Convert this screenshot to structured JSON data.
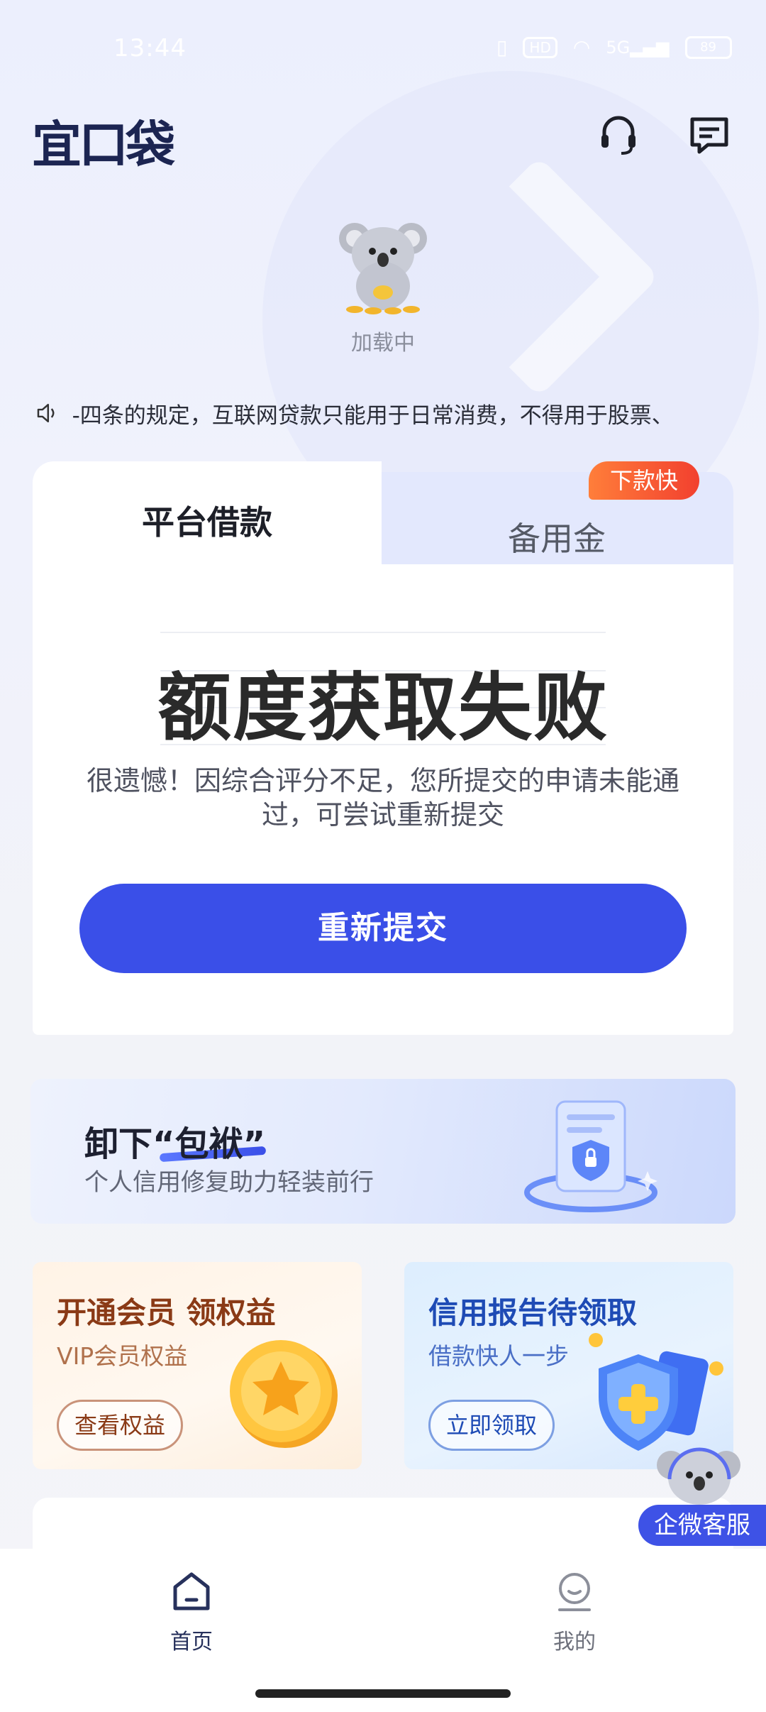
{
  "status_bar": {
    "time": "13:44",
    "hd": "HD",
    "network": "5G",
    "battery": "89"
  },
  "header": {
    "logo": "宜口袋",
    "service_icon": "headset-icon",
    "message_icon": "message-icon"
  },
  "loading": {
    "text": "加载中"
  },
  "notice": {
    "icon": "speaker-icon",
    "text": "-四条的规定，互联网贷款只能用于日常消费，不得用于股票、"
  },
  "loan_card": {
    "tabs": [
      {
        "label": "平台借款",
        "active": true
      },
      {
        "label": "备用金",
        "active": false,
        "badge": "下款快"
      }
    ],
    "status_title": "额度获取失败",
    "status_desc": "很遗憾！因综合评分不足，您所提交的申请未能通过，可尝试重新提交",
    "button_label": "重新提交"
  },
  "banner": {
    "title_prefix": "卸下",
    "title_highlight": "“包袱”",
    "subtitle": "个人信用修复助力轻装前行"
  },
  "promos": [
    {
      "title": "开通会员 领权益",
      "subtitle": "VIP会员权益",
      "button": "查看权益"
    },
    {
      "title": "信用报告待领取",
      "subtitle": "借款快人一步",
      "button": "立即领取"
    }
  ],
  "customer_service": {
    "label": "企微客服"
  },
  "bottom_nav": [
    {
      "label": "首页",
      "icon": "home-icon",
      "active": true
    },
    {
      "label": "我的",
      "icon": "profile-icon",
      "active": false
    }
  ],
  "colors": {
    "primary": "#3a4fe8",
    "badge": "#f2402f",
    "logo": "#1c2552"
  }
}
